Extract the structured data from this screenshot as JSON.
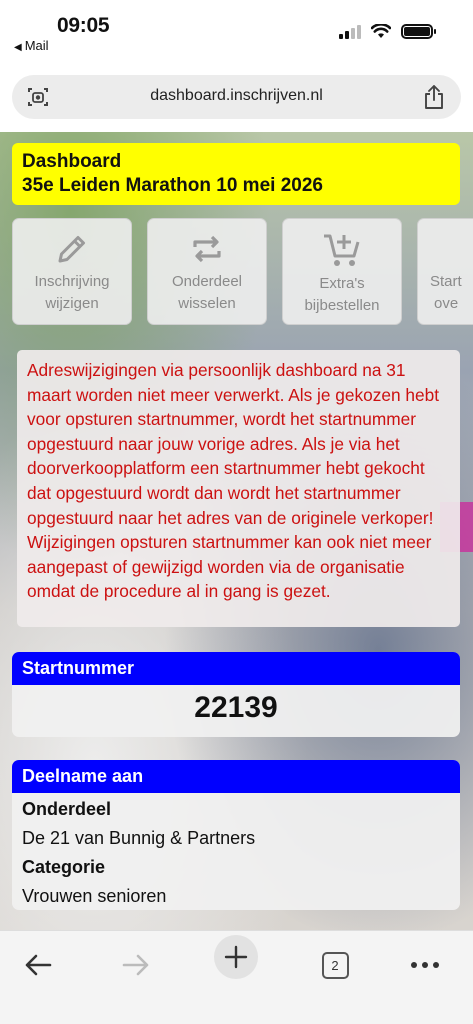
{
  "status_bar": {
    "time": "09:05",
    "back_label": "Mail"
  },
  "browser": {
    "url": "dashboard.inschrijven.nl",
    "tab_count": "2"
  },
  "dashboard": {
    "title": "Dashboard",
    "event": "35e Leiden Marathon 10 mei 2026"
  },
  "actions": [
    {
      "line1": "Inschrijving",
      "line2": "wijzigen",
      "icon": "pencil-icon"
    },
    {
      "line1": "Onderdeel",
      "line2": "wisselen",
      "icon": "swap-icon"
    },
    {
      "line1": "Extra's",
      "line2": "bijbestellen",
      "icon": "cart-add-icon"
    },
    {
      "line1": "Start",
      "line2": "ove",
      "icon": "plus-icon"
    }
  ],
  "notice": "Adreswijzigingen via persoonlijk dashboard na 31 maart worden niet meer verwerkt. Als je gekozen hebt voor opsturen startnummer, wordt het startnummer opgestuurd naar jouw vorige adres. Als je via het doorverkoopplatform een startnummer hebt gekocht dat opgestuurd wordt dan wordt het startnummer opgestuurd naar het adres van de originele verkoper! Wijzigingen opsturen startnummer kan ook niet meer aangepast of gewijzigd worden via de organisatie omdat de procedure al in gang is gezet.",
  "startnummer": {
    "label": "Startnummer",
    "value": "22139"
  },
  "deelname": {
    "label": "Deelname aan",
    "onderdeel_label": "Onderdeel",
    "onderdeel_value": "De 21 van Bunnig & Partners",
    "categorie_label": "Categorie",
    "categorie_value": "Vrouwen senioren"
  },
  "colors": {
    "header_yellow": "#ffff00",
    "card_blue": "#0000ff",
    "notice_red": "#cc1111"
  }
}
